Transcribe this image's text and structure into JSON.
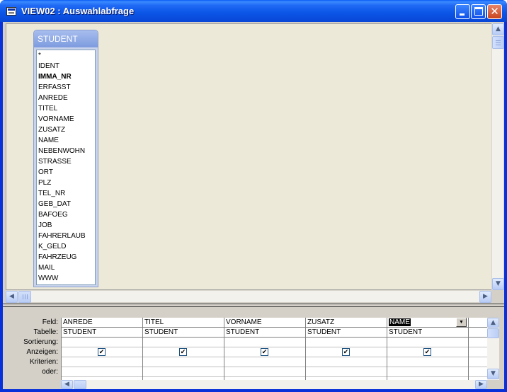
{
  "window": {
    "title": "VIEW02 : Auswahlabfrage",
    "minimize_icon": "minimize-icon",
    "maximize_icon": "maximize-icon",
    "close_icon": "close-icon",
    "close_glyph": "✕"
  },
  "table_box": {
    "title": "STUDENT",
    "fields": [
      {
        "label": "*",
        "primary": false
      },
      {
        "label": "IDENT",
        "primary": false
      },
      {
        "label": "IMMA_NR",
        "primary": true
      },
      {
        "label": "ERFASST",
        "primary": false
      },
      {
        "label": "ANREDE",
        "primary": false
      },
      {
        "label": "TITEL",
        "primary": false
      },
      {
        "label": "VORNAME",
        "primary": false
      },
      {
        "label": "ZUSATZ",
        "primary": false
      },
      {
        "label": "NAME",
        "primary": false
      },
      {
        "label": "NEBENWOHN",
        "primary": false
      },
      {
        "label": "STRASSE",
        "primary": false
      },
      {
        "label": "ORT",
        "primary": false
      },
      {
        "label": "PLZ",
        "primary": false
      },
      {
        "label": "TEL_NR",
        "primary": false
      },
      {
        "label": "GEB_DAT",
        "primary": false
      },
      {
        "label": "BAFOEG",
        "primary": false
      },
      {
        "label": "JOB",
        "primary": false
      },
      {
        "label": "FAHRERLAUB",
        "primary": false
      },
      {
        "label": "K_GELD",
        "primary": false
      },
      {
        "label": "FAHRZEUG",
        "primary": false
      },
      {
        "label": "MAIL",
        "primary": false
      },
      {
        "label": "WWW",
        "primary": false
      }
    ]
  },
  "grid": {
    "row_labels": {
      "feld": "Feld:",
      "tabelle": "Tabelle:",
      "sortierung": "Sortierung:",
      "anzeigen": "Anzeigen:",
      "kriterien": "Kriterien:",
      "oder": "oder:"
    },
    "columns": [
      {
        "field": "ANREDE",
        "table": "STUDENT",
        "show": true,
        "selected": false
      },
      {
        "field": "TITEL",
        "table": "STUDENT",
        "show": true,
        "selected": false
      },
      {
        "field": "VORNAME",
        "table": "STUDENT",
        "show": true,
        "selected": false
      },
      {
        "field": "ZUSATZ",
        "table": "STUDENT",
        "show": true,
        "selected": false
      },
      {
        "field": "NAME",
        "table": "STUDENT",
        "show": true,
        "selected": true
      }
    ],
    "check_glyph": "✔",
    "dropdown_glyph": "▼"
  },
  "scroll": {
    "up": "▲",
    "down": "▼",
    "left": "◀",
    "right": "▶"
  }
}
